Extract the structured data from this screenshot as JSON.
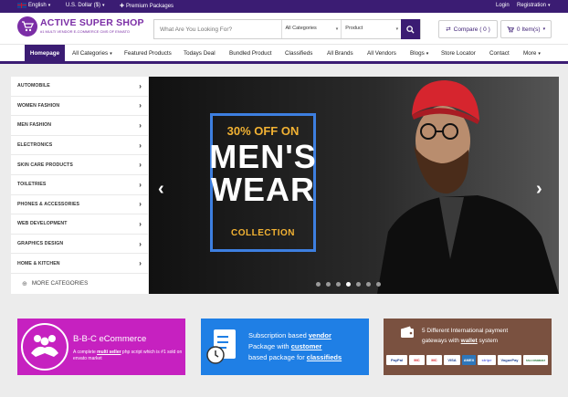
{
  "topbar": {
    "language": "English",
    "currency": "U.S. Dollar ($)",
    "premium": "Premium Packages",
    "login": "Login",
    "registration": "Registration"
  },
  "header": {
    "logo_title": "ACTIVE SUPER SHOP",
    "logo_tagline": "#1 MULTI VENDOR E-COMMERCE CMS OF ENVATO",
    "search_placeholder": "What Are You Looking For?",
    "category_select": "All Categories",
    "type_select": "Product",
    "compare_label": "Compare ( 0 )",
    "cart_label": "0 Item(s)"
  },
  "nav": {
    "items": [
      "Homepage",
      "All Categories",
      "Featured Products",
      "Todays Deal",
      "Bundled Product",
      "Classifieds",
      "All Brands",
      "All Vendors",
      "Blogs",
      "Store Locator",
      "Contact",
      "More"
    ]
  },
  "sidebar": {
    "categories": [
      "AUTOMOBILE",
      "WOMEN FASHION",
      "MEN FASHION",
      "ELECTRONICS",
      "SKIN CARE PRODUCTS",
      "TOILETRIES",
      "PHONES & ACCESSORIES",
      "WEB DEVELOPMENT",
      "GRAPHICS DESIGN",
      "HOME & KITCHEN"
    ],
    "more_label": "MORE CATEGORIES"
  },
  "slider": {
    "offer": "30% OFF ON",
    "line1": "MEN'S",
    "line2": "WEAR",
    "line3": "COLLECTION",
    "slide_count": 7,
    "active_slide": 4
  },
  "banners": {
    "b1_title": "B-B-C eCommerce",
    "b1_sub_pre": "A complete ",
    "b1_sub_link": "multi seller",
    "b1_sub_post": " php script which is #1 sold on envato market",
    "b2_l1_pre": "Subscription based ",
    "b2_l1_link": "vendor",
    "b2_l2_pre": "Package with ",
    "b2_l2_link": "customer",
    "b2_l3_pre": "based package for ",
    "b2_l3_link": "classifieds",
    "b3_l1": "5 Different International payment",
    "b3_l2_pre": "gateways with ",
    "b3_l2_link": "wallet",
    "b3_l2_post": " system",
    "payments": [
      "PayPal",
      "MC",
      "MC",
      "VISA",
      "AMEX",
      "stripe",
      "VoguePay",
      "SSLCOMMERZ"
    ]
  },
  "colors": {
    "brand_purple": "#3b1c73",
    "logo_purple": "#7b2ea6",
    "banner_magenta": "#c621c0",
    "banner_blue": "#1f7fe5",
    "banner_brown": "#7a5140",
    "promo_gold": "#f2b233",
    "frame_blue": "#3d7fe0"
  }
}
